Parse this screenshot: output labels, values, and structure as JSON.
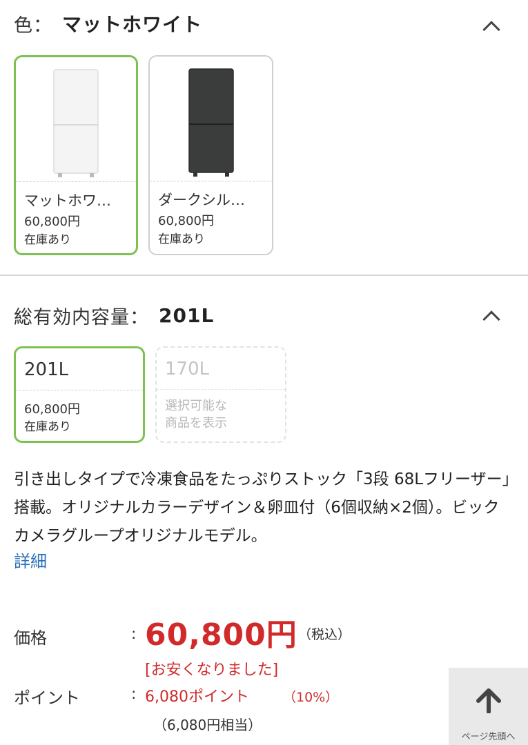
{
  "color_section": {
    "label": "色：",
    "value": "マットホワイト",
    "options": [
      {
        "name": "マットホワ…",
        "price": "60,800円",
        "stock": "在庫あり",
        "selected": true,
        "fridge_color": "#f2f2f2"
      },
      {
        "name": "ダークシル…",
        "price": "60,800円",
        "stock": "在庫あり",
        "selected": false,
        "fridge_color": "#3a3d3c"
      }
    ]
  },
  "capacity_section": {
    "label": "総有効内容量：",
    "value": "201L",
    "options": [
      {
        "size": "201L",
        "price": "60,800円",
        "stock": "在庫あり",
        "selected": true
      },
      {
        "size": "170L",
        "note_line1": "選択可能な",
        "note_line2": "商品を表示",
        "selected": false
      }
    ]
  },
  "description": "引き出しタイプで冷凍食品をたっぷりストック「3段 68Lフリーザー」搭載。オリジナルカラーデザイン＆卵皿付（6個収納×2個）。ビックカメラグループオリジナルモデル。",
  "detail_link": "詳細",
  "pricing": {
    "price_label": "価格",
    "colon": ":",
    "price": "60,800円",
    "tax_note": "（税込）",
    "discount_note": "[お安くなりました]",
    "point_label": "ポイント",
    "points": "6,080ポイント",
    "points_rate": "（10%）",
    "points_equiv": "（6,080円相当）"
  },
  "back_to_top": {
    "arrow": "🡅",
    "label": "ページ先頭へ"
  },
  "colors": {
    "selected_border": "#7cc152",
    "price_red": "#d12a2a",
    "link_blue": "#2a6fb8"
  }
}
